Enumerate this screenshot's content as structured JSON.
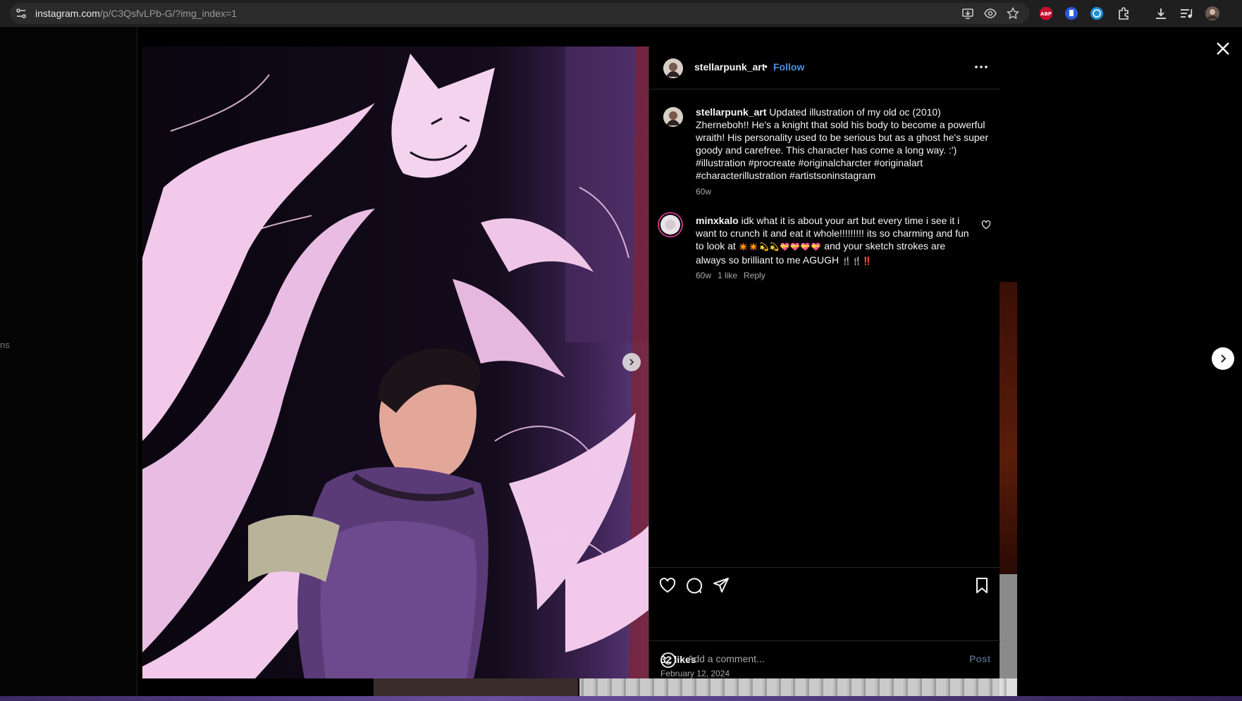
{
  "browser": {
    "url_host": "instagram.com",
    "url_path": "/p/C3QsfvLPb-G/?img_index=1",
    "extensions": [
      "abp-icon",
      "doc-icon",
      "translate-icon",
      "puzzle-icon",
      "download-icon",
      "playlist-icon",
      "profile-avatar-icon"
    ]
  },
  "backdrop": {
    "side_text": "ns"
  },
  "post": {
    "author": "stellarpunk_art",
    "separator": "•",
    "follow_label": "Follow",
    "caption_text": "Updated illustration of my old oc (2010) Zherneboh!! He's a knight that sold his body to become a powerful wraith! His personality used to be serious but as a ghost he's super goody and carefree. This character has come a long way. :')",
    "caption_tags": "#illustration #procreate #originalcharcter #originalart #characterillustration #artistsoninstagram",
    "caption_time": "60w",
    "likes": "32 likes",
    "date": "February 12, 2024"
  },
  "comments": [
    {
      "user": "minxkalo",
      "text_a": "idk what it is about your art but every time i see it i want to crunch it and eat it whole!!!!!!!!! its so charming and fun to look at",
      "emoji_a": "✴️✴️💫💫💝💝💝💝",
      "text_b": "and your sketch strokes are always so brilliant to me AGUGH",
      "emoji_b": "🍴🍴‼️",
      "time": "60w",
      "likes": "1 like",
      "reply_label": "Reply"
    }
  ],
  "composer": {
    "placeholder": "Add a comment...",
    "post_label": "Post"
  },
  "colors": {
    "follow": "#4a90e2",
    "post_disabled": "#4c5a75",
    "art_pink": "#f2c9ea",
    "art_purple": "#5a3b78"
  }
}
